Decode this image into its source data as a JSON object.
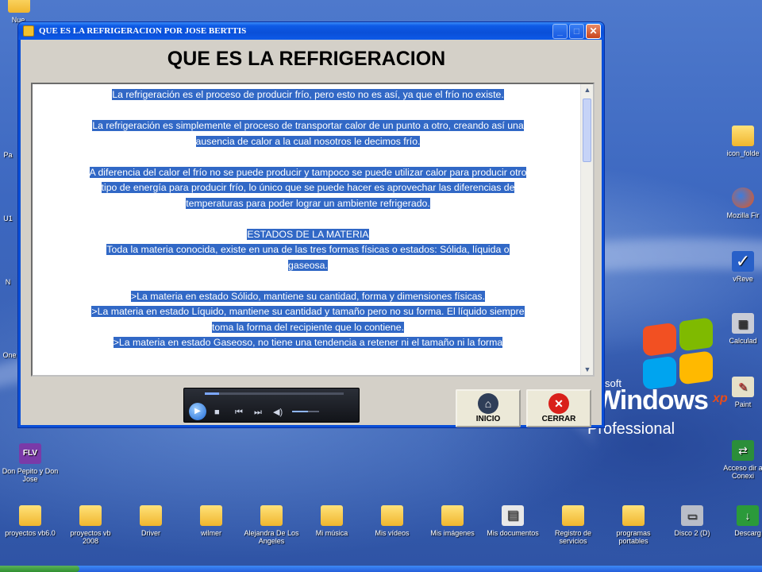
{
  "window": {
    "title": "QUE ES LA REFRIGERACION POR JOSE BERTTIS",
    "buttons": {
      "minimize": "_",
      "maximize": "□",
      "close": "✕"
    }
  },
  "form": {
    "heading": "QUE ES LA REFRIGERACION",
    "paragraphs": [
      [
        "La refrigeración es el proceso de producir frío, pero esto no es así, ya que el frío no existe."
      ],
      [
        "La refrigeración es simplemente el proceso de transportar calor de un punto a otro, creando así una",
        "ausencia de calor a la cual nosotros le decimos frío."
      ],
      [
        "A diferencia del calor el frío no se puede producir y tampoco se puede utilizar calor para producir otro",
        "tipo de energía para producir frío, lo único que se puede hacer es aprovechar las diferencias de",
        "temperaturas para poder lograr un ambiente refrigerado."
      ],
      [
        "ESTADOS DE LA MATERIA",
        "Toda la materia conocida, existe en una de las tres formas físicas o estados: Sólida, líquida o",
        "gaseosa."
      ],
      [
        ">La materia en estado Sólido, mantiene su cantidad, forma y dimensiones físicas.",
        ">La materia en estado Líquido, mantiene su cantidad y tamaño pero no su forma.  El líquido siempre",
        "toma la forma del recipiente que lo contiene.",
        ">La materia en estado Gaseoso, no tiene una tendencia a retener ni el tamaño ni la forma"
      ]
    ],
    "player_progress": 0.1,
    "player_volume": 0.6,
    "inicio_label": "INICIO",
    "cerrar_label": "CERRAR"
  },
  "branding": {
    "microsoft": "soft",
    "windows": "Windows",
    "xp": "xp",
    "edition": "Professional"
  },
  "desktop_icons_right": [
    {
      "label": "icon_folde",
      "glyph": "folder-icon"
    },
    {
      "label": "Mozilla Fir",
      "glyph": "firefox-icon"
    },
    {
      "label": "vReve",
      "glyph": "app-icon"
    },
    {
      "label": "Calculad",
      "glyph": "calculator-icon"
    },
    {
      "label": "Paint",
      "glyph": "paint-icon"
    },
    {
      "label": "Acceso dir a Conexi",
      "glyph": "network-icon"
    }
  ],
  "desktop_icons_left": [
    {
      "label": "Nue"
    },
    {
      "label": "Pa"
    },
    {
      "label": "U1"
    },
    {
      "label": "N"
    },
    {
      "label": "One"
    },
    {
      "label": "Don Pepito y Don Jose"
    }
  ],
  "desktop_icons_bottom": [
    {
      "label": "proyectos vb6.0"
    },
    {
      "label": "proyectos vb 2008"
    },
    {
      "label": "Driver"
    },
    {
      "label": "wilmer"
    },
    {
      "label": "Alejandra De Los Angeles"
    },
    {
      "label": "Mi música"
    },
    {
      "label": "Mis vídeos"
    },
    {
      "label": "Mis imágenes"
    },
    {
      "label": "Mis documentos"
    },
    {
      "label": "Registro de servicios"
    },
    {
      "label": "programas portables"
    },
    {
      "label": "Disco 2 (D)"
    },
    {
      "label": "Descarg"
    }
  ]
}
